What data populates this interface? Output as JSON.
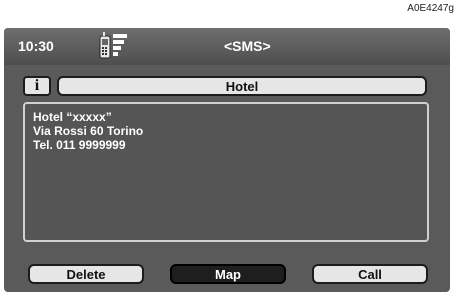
{
  "ref_code": "A0E4247g",
  "header": {
    "time": "10:30",
    "title": "<SMS>",
    "status_icon": "phone-signal-icon"
  },
  "message": {
    "title": "Hotel",
    "info_label": "i",
    "lines": [
      "Hotel “xxxxx”",
      "Via Rossi 60 Torino",
      "Tel. 011 9999999"
    ]
  },
  "buttons": {
    "delete": "Delete",
    "map": "Map",
    "call": "Call"
  },
  "colors": {
    "screen_bg": "#5a5a5a",
    "button_light": "#e6e6e6",
    "button_selected": "#1e1e1e"
  }
}
